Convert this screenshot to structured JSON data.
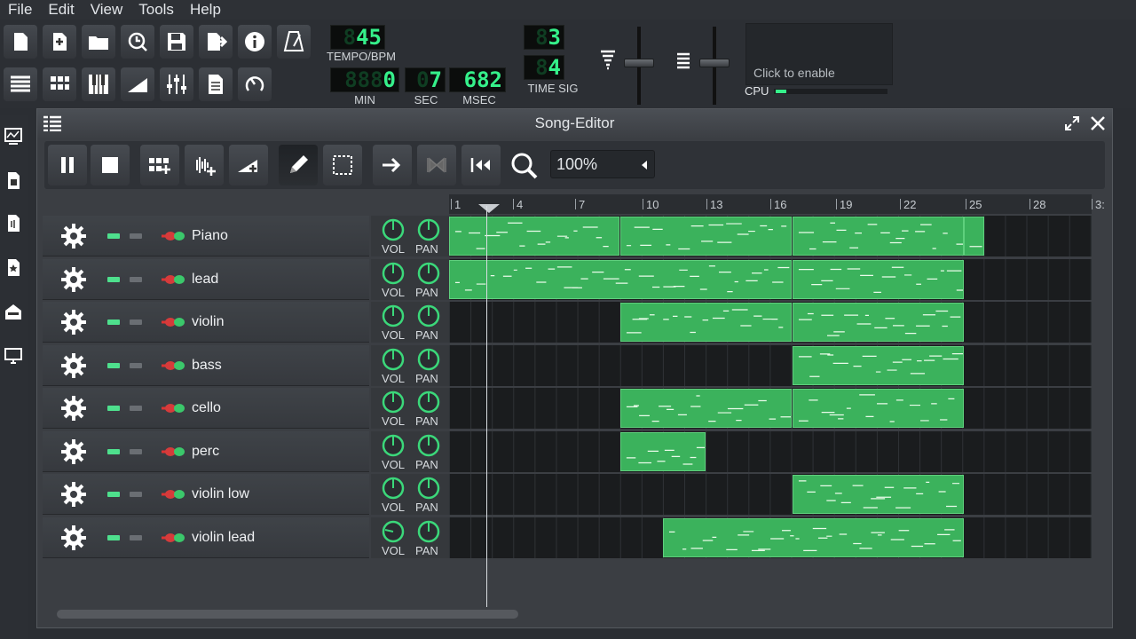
{
  "menu": {
    "items": [
      "File",
      "Edit",
      "View",
      "Tools",
      "Help"
    ]
  },
  "toolbar": {
    "buttons_row1": [
      "new-project",
      "new-from-template",
      "open-project",
      "recent-projects",
      "save-project",
      "export",
      "about",
      "metronome"
    ],
    "buttons_row2": [
      "song-editor",
      "beat-bassline-editor",
      "piano-roll",
      "automation-editor",
      "mixer",
      "project-notes",
      "controller-rack"
    ]
  },
  "transport": {
    "tempo": {
      "value": "45",
      "ghost": "8",
      "label": "TEMPO/BPM"
    },
    "min": {
      "value": "0",
      "ghost": "888",
      "label": "MIN"
    },
    "sec": {
      "value": "7",
      "ghost": "0",
      "label": "SEC"
    },
    "msec": {
      "value": "682",
      "label": "MSEC"
    },
    "timesig": {
      "num": "3",
      "den": "4",
      "ghost": "8",
      "label": "TIME SIG"
    }
  },
  "cpu": {
    "click_label": "Click to enable",
    "label": "CPU",
    "level": 0.1
  },
  "song_editor": {
    "title": "Song-Editor",
    "zoom": "100%",
    "ruler": [
      "1",
      "4",
      "7",
      "10",
      "13",
      "16",
      "19",
      "22",
      "25",
      "28",
      "3:"
    ],
    "tracks": [
      {
        "name": "Piano"
      },
      {
        "name": "lead"
      },
      {
        "name": "violin"
      },
      {
        "name": "bass"
      },
      {
        "name": "cello"
      },
      {
        "name": "perc"
      },
      {
        "name": "violin low"
      },
      {
        "name": "violin lead"
      }
    ],
    "knob_labels": {
      "vol": "VOL",
      "pan": "PAN"
    },
    "colors": {
      "pattern": "#3bb25c",
      "led": "#35f08a"
    }
  }
}
